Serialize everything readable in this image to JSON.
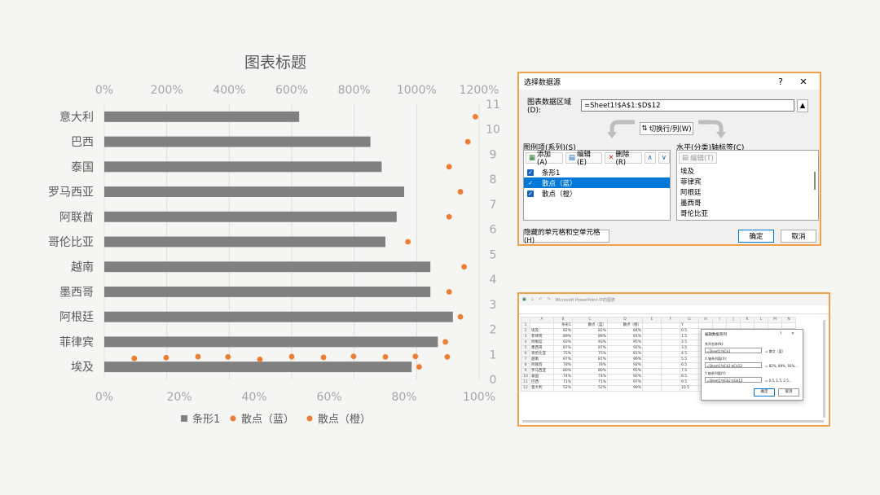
{
  "chart_data": {
    "type": "bar",
    "title": "图表标题",
    "categories": [
      "埃及",
      "菲律宾",
      "阿根廷",
      "墨西哥",
      "越南",
      "哥伦比亚",
      "阿联酋",
      "罗马西亚",
      "泰国",
      "巴西",
      "意大利"
    ],
    "series": [
      {
        "name": "条形1",
        "type": "bar",
        "color": "#808080",
        "values": [
          82,
          89,
          93,
          87,
          87,
          75,
          78,
          80,
          74,
          71,
          52
        ]
      },
      {
        "name": "散点（蓝）",
        "type": "scatter",
        "color": "#ed7d31",
        "x": [
          84,
          91,
          95,
          92,
          96,
          81,
          92,
          95,
          92,
          97,
          99
        ],
        "y": [
          0.5,
          1.5,
          2.5,
          3.5,
          4.5,
          5.5,
          6.5,
          7.5,
          8.5,
          9.5,
          10.5
        ]
      },
      {
        "name": "散点（橙）",
        "type": "scatter",
        "color": "#ed7d31",
        "x": [
          8,
          16.5,
          25,
          33,
          41.5,
          50,
          58.5,
          66.5,
          75,
          83,
          91.5
        ],
        "y": [
          0.84,
          0.87,
          0.91,
          0.9,
          0.8,
          0.91,
          0.88,
          0.92,
          0.9,
          0.92,
          0.9
        ]
      }
    ],
    "top_axis": {
      "min": 0,
      "max": 1200,
      "ticks": [
        "0%",
        "200%",
        "400%",
        "600%",
        "800%",
        "1000%",
        "1200%"
      ]
    },
    "bottom_axis": {
      "min": 0,
      "max": 100,
      "ticks": [
        "0%",
        "20%",
        "40%",
        "60%",
        "80%",
        "100%"
      ]
    },
    "right_axis": {
      "min": 0,
      "max": 11,
      "ticks": [
        "0",
        "1",
        "2",
        "3",
        "4",
        "5",
        "6",
        "7",
        "8",
        "9",
        "10",
        "11"
      ]
    },
    "grid": true,
    "legend_position": "bottom",
    "legend": [
      "条形1",
      "散点（蓝）",
      "散点（橙）"
    ]
  },
  "dialog": {
    "title": "选择数据源",
    "help": "?",
    "close": "✕",
    "range_label": "图表数据区域(D):",
    "range_value": "=Sheet1!$A$1:$D$12",
    "switch_label": "切换行/列(W)",
    "series_header": "图例项(系列)(S)",
    "axis_header": "水平(分类)轴标签(C)",
    "add": "添加(A)",
    "edit": "编辑(E)",
    "remove": "删除(R)",
    "axis_edit": "编辑(T)",
    "series_items": [
      "条形1",
      "散点（蓝）",
      "散点（橙）"
    ],
    "axis_items": [
      "埃及",
      "菲律宾",
      "阿根廷",
      "墨西哥",
      "哥伦比亚"
    ],
    "hidden_cells": "隐藏的单元格和空单元格(H)",
    "ok": "确定",
    "cancel": "取消"
  },
  "excel": {
    "title": "Microsoft PowerPoint 中的图表",
    "columns": [
      "",
      "A",
      "B",
      "C",
      "D",
      "E",
      "F",
      "G",
      "H",
      "I",
      "J",
      "K",
      "L",
      "M",
      "N"
    ],
    "rows": [
      [
        "1",
        "",
        "条形1",
        "散点（蓝）",
        "散点（橙）",
        "",
        "",
        "Y",
        "",
        "",
        "",
        "",
        "",
        "",
        ""
      ],
      [
        "2",
        "埃及",
        "82%",
        "82%",
        "84%",
        "",
        "",
        "0.5",
        "",
        "",
        "",
        "",
        "",
        "",
        ""
      ],
      [
        "3",
        "菲律宾",
        "89%",
        "89%",
        "91%",
        "",
        "",
        "1.5",
        "",
        "",
        "",
        "",
        "",
        "",
        ""
      ],
      [
        "4",
        "阿根廷",
        "93%",
        "93%",
        "95%",
        "",
        "",
        "2.5",
        "",
        "",
        "",
        "",
        "",
        "",
        ""
      ],
      [
        "5",
        "墨西哥",
        "87%",
        "87%",
        "92%",
        "",
        "",
        "3.5",
        "",
        "",
        "",
        "",
        "",
        "",
        ""
      ],
      [
        "6",
        "哥伦比亚",
        "75%",
        "75%",
        "81%",
        "",
        "",
        "4.5",
        "",
        "",
        "",
        "",
        "",
        "",
        ""
      ],
      [
        "7",
        "越南",
        "87%",
        "87%",
        "96%",
        "",
        "",
        "5.5",
        "",
        "",
        "",
        "",
        "",
        "",
        ""
      ],
      [
        "8",
        "阿联酋",
        "78%",
        "78%",
        "92%",
        "",
        "",
        "6.5",
        "",
        "",
        "",
        "",
        "",
        "",
        ""
      ],
      [
        "9",
        "罗马西亚",
        "80%",
        "80%",
        "95%",
        "",
        "",
        "7.5",
        "",
        "",
        "",
        "",
        "",
        "",
        ""
      ],
      [
        "10",
        "泰国",
        "74%",
        "74%",
        "92%",
        "",
        "",
        "8.5",
        "",
        "",
        "",
        "",
        "",
        "",
        ""
      ],
      [
        "11",
        "巴西",
        "71%",
        "71%",
        "97%",
        "",
        "",
        "9.5",
        "",
        "",
        "",
        "",
        "",
        "",
        ""
      ],
      [
        "12",
        "意大利",
        "52%",
        "52%",
        "99%",
        "",
        "",
        "10.5",
        "",
        "",
        "",
        "",
        "",
        "",
        ""
      ]
    ],
    "sub_dialog": {
      "title": "编辑数据系列",
      "name_label": "系列名称(N):",
      "name_value": "=Sheet1!$C$1",
      "name_result": "= 散点（蓝）",
      "x_label": "X 轴系列值(X):",
      "x_value": "=Sheet1!$C$2:$C$12",
      "x_result": "= 82%, 89%, 93%...",
      "y_label": "Y 轴系列值(Y):",
      "y_value": "=Sheet1!$G$2:$G$12",
      "y_result": "= 0.5, 1.5, 2.5...",
      "ok": "确定",
      "cancel": "取消"
    }
  }
}
